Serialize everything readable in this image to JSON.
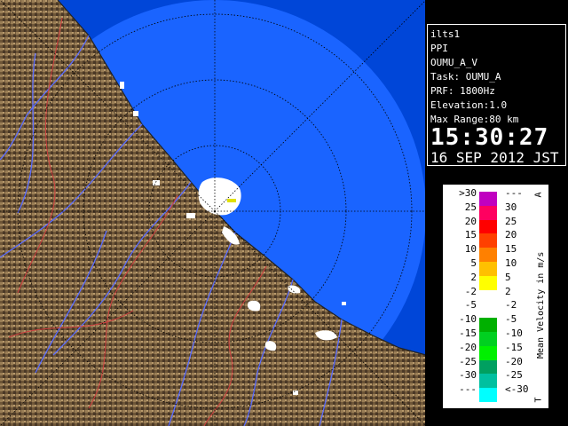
{
  "info": {
    "station": "ilts1",
    "mode": "PPI",
    "product": "OUMU_A_V",
    "task": "Task: OUMU_A",
    "prf": "PRF: 1800Hz",
    "elevation": "Elevation:1.0",
    "max_range": "Max Range:80 km",
    "time": "15:30:27",
    "date": "16 SEP 2012 JST"
  },
  "legend": {
    "title": "Mean Velocity in m/s",
    "top_mark": "A",
    "bottom_mark": "T",
    "left_labels": [
      ">30",
      "25",
      "20",
      "15",
      "10",
      "5",
      "2",
      "-2",
      "-5",
      "-10",
      "-15",
      "-20",
      "-25",
      "-30",
      "---"
    ],
    "right_labels": [
      "---",
      "30",
      "25",
      "20",
      "15",
      "10",
      "5",
      "2",
      "-2",
      "-5",
      "-10",
      "-15",
      "-20",
      "-25",
      "<-30"
    ],
    "colors": [
      "#c000c0",
      "#ff0060",
      "#ff0000",
      "#ff4000",
      "#ff8000",
      "#ffc000",
      "#ffff00",
      "#ffffff",
      "#ffffff",
      "#00b000",
      "#00d020",
      "#00f000",
      "#00a060",
      "#00c0a0",
      "#00ffff"
    ]
  },
  "map": {
    "sea_color": "#1a64ff",
    "outer_ring_color": "#0046d8",
    "land_color": "#7a6040"
  }
}
